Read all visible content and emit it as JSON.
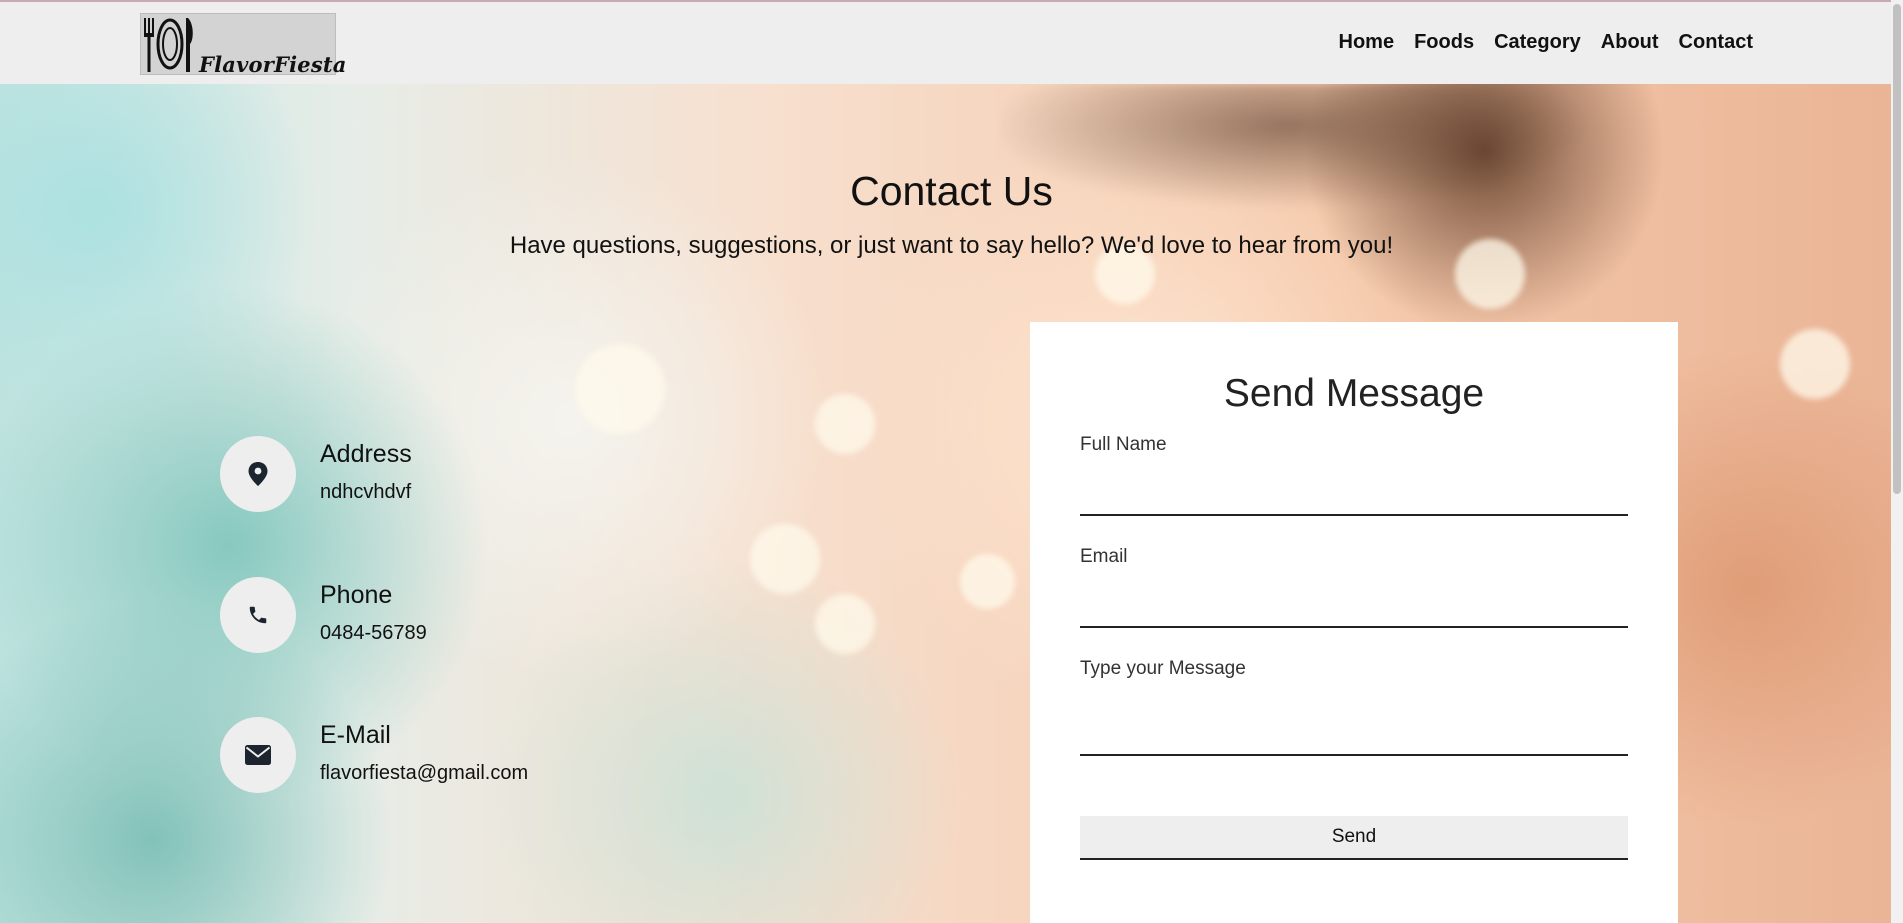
{
  "brand": {
    "name": "FlavorFiesta",
    "logo_icon": "plate-fork-knife-icon"
  },
  "nav": {
    "items": [
      {
        "label": "Home"
      },
      {
        "label": "Foods"
      },
      {
        "label": "Category"
      },
      {
        "label": "About"
      },
      {
        "label": "Contact"
      }
    ]
  },
  "hero": {
    "title": "Contact Us",
    "subtitle": "Have questions, suggestions, or just want to say hello? We'd love to hear from you!"
  },
  "contact_info": {
    "address": {
      "icon": "map-pin-icon",
      "label": "Address",
      "value": "ndhcvhdvf"
    },
    "phone": {
      "icon": "phone-icon",
      "label": "Phone",
      "value": "0484-56789"
    },
    "email": {
      "icon": "envelope-icon",
      "label": "E-Mail",
      "value": "flavorfiesta@gmail.com"
    }
  },
  "form": {
    "title": "Send Message",
    "full_name_label": "Full Name",
    "full_name_value": "",
    "email_label": "Email",
    "email_value": "",
    "message_label": "Type your Message",
    "message_value": "",
    "send_label": "Send"
  },
  "colors": {
    "navbar_bg": "#eeeeee",
    "card_bg": "#ffffff",
    "icon_circle_bg": "#eeeeee",
    "text": "#111111"
  }
}
